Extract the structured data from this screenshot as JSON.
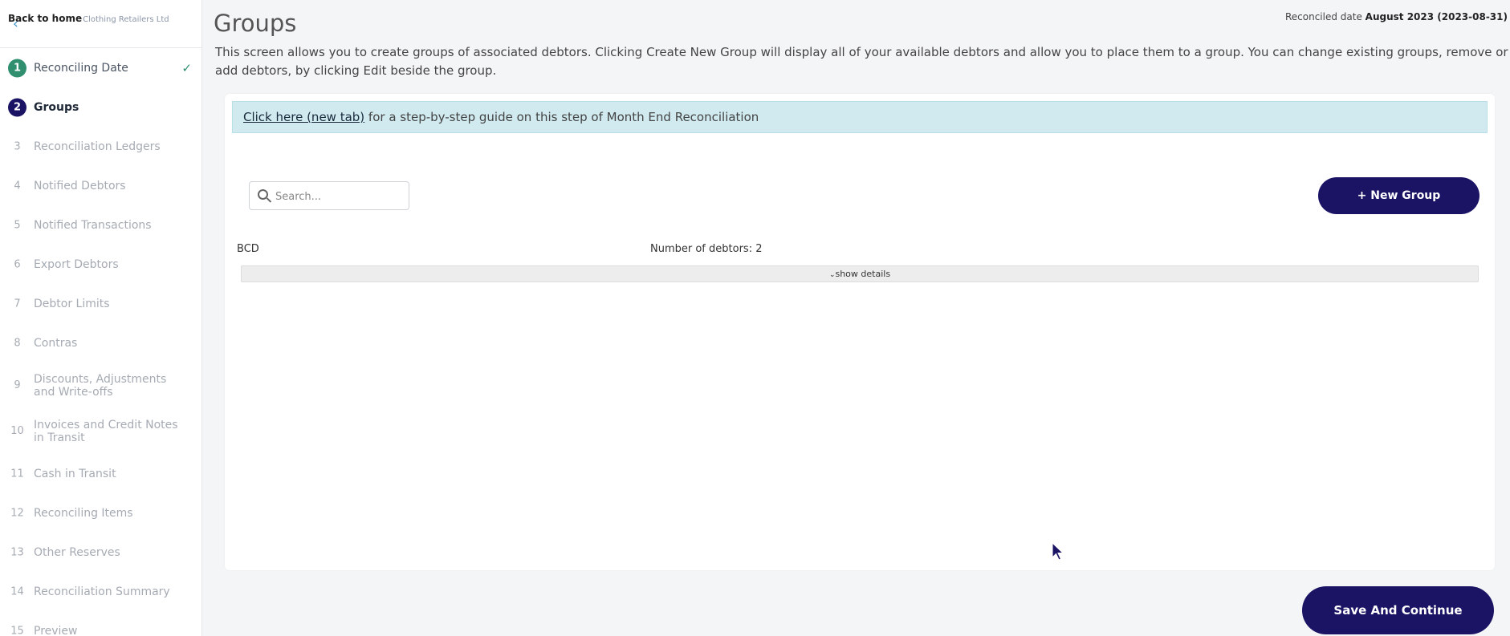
{
  "sidebar": {
    "back_label": "Back to home",
    "company": "Clothing Retailers Ltd",
    "steps": [
      {
        "num": "1",
        "label": "Reconciling Date"
      },
      {
        "num": "2",
        "label": "Groups"
      },
      {
        "num": "3",
        "label": "Reconciliation Ledgers"
      },
      {
        "num": "4",
        "label": "Notified Debtors"
      },
      {
        "num": "5",
        "label": "Notified Transactions"
      },
      {
        "num": "6",
        "label": "Export Debtors"
      },
      {
        "num": "7",
        "label": "Debtor Limits"
      },
      {
        "num": "8",
        "label": "Contras"
      },
      {
        "num": "9",
        "label": "Discounts, Adjustments and Write-offs"
      },
      {
        "num": "10",
        "label": "Invoices and Credit Notes in Transit"
      },
      {
        "num": "11",
        "label": "Cash in Transit"
      },
      {
        "num": "12",
        "label": "Reconciling Items"
      },
      {
        "num": "13",
        "label": "Other Reserves"
      },
      {
        "num": "14",
        "label": "Reconciliation Summary"
      },
      {
        "num": "15",
        "label": "Preview"
      }
    ],
    "check_icon": "✓"
  },
  "header": {
    "title": "Groups",
    "reconciled_label": "Reconciled date",
    "reconciled_value": "August 2023 (2023-08-31)",
    "intro": "This screen allows you to create groups of associated debtors. Clicking Create New Group will display all of your available debtors and allow you to place them to a group. You can change existing groups, remove or add debtors, by clicking Edit beside the group."
  },
  "guide": {
    "link_text": "Click here (new tab)",
    "rest": " for a step-by-step guide on this step of Month End Reconciliation"
  },
  "search": {
    "placeholder": "Search..."
  },
  "new_group_label": "+ New Group",
  "groups": [
    {
      "name": "BCD",
      "count_label": "Number of debtors:",
      "count_value": "2",
      "details_label": "show details"
    }
  ],
  "save_label": "Save And Continue",
  "colors": {
    "primary": "#1b1464",
    "success": "#2f8f6f",
    "info_bg": "#d0eaf0"
  }
}
